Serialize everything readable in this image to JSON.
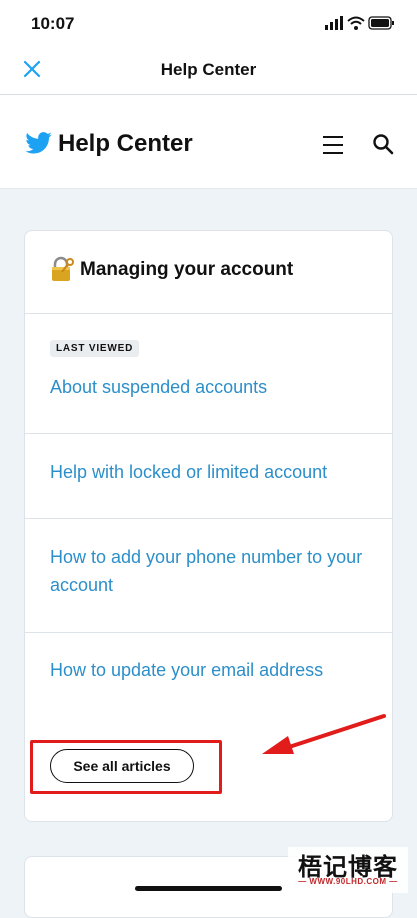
{
  "status_bar": {
    "time": "10:07"
  },
  "nav_bar": {
    "title": "Help Center",
    "close_icon": "close-icon"
  },
  "site_header": {
    "title": "Help Center",
    "logo_icon": "twitter-bird-icon",
    "menu_icon": "menu-icon",
    "search_icon": "search-icon"
  },
  "card": {
    "icon": "lock-with-key-icon",
    "title": "Managing your account",
    "badge": "LAST VIEWED",
    "articles": [
      {
        "label": "About suspended accounts"
      },
      {
        "label": "Help with locked or limited account"
      },
      {
        "label": "How to add your phone number to your account"
      },
      {
        "label": "How to update your email address"
      }
    ],
    "see_all_label": "See all articles"
  },
  "watermark": {
    "text": "梧记博客",
    "url": "— WWW.90LHD.COM —"
  },
  "colors": {
    "link": "#2c8fc9",
    "accent": "#1da1f2",
    "annotation": "#e21b1b"
  }
}
